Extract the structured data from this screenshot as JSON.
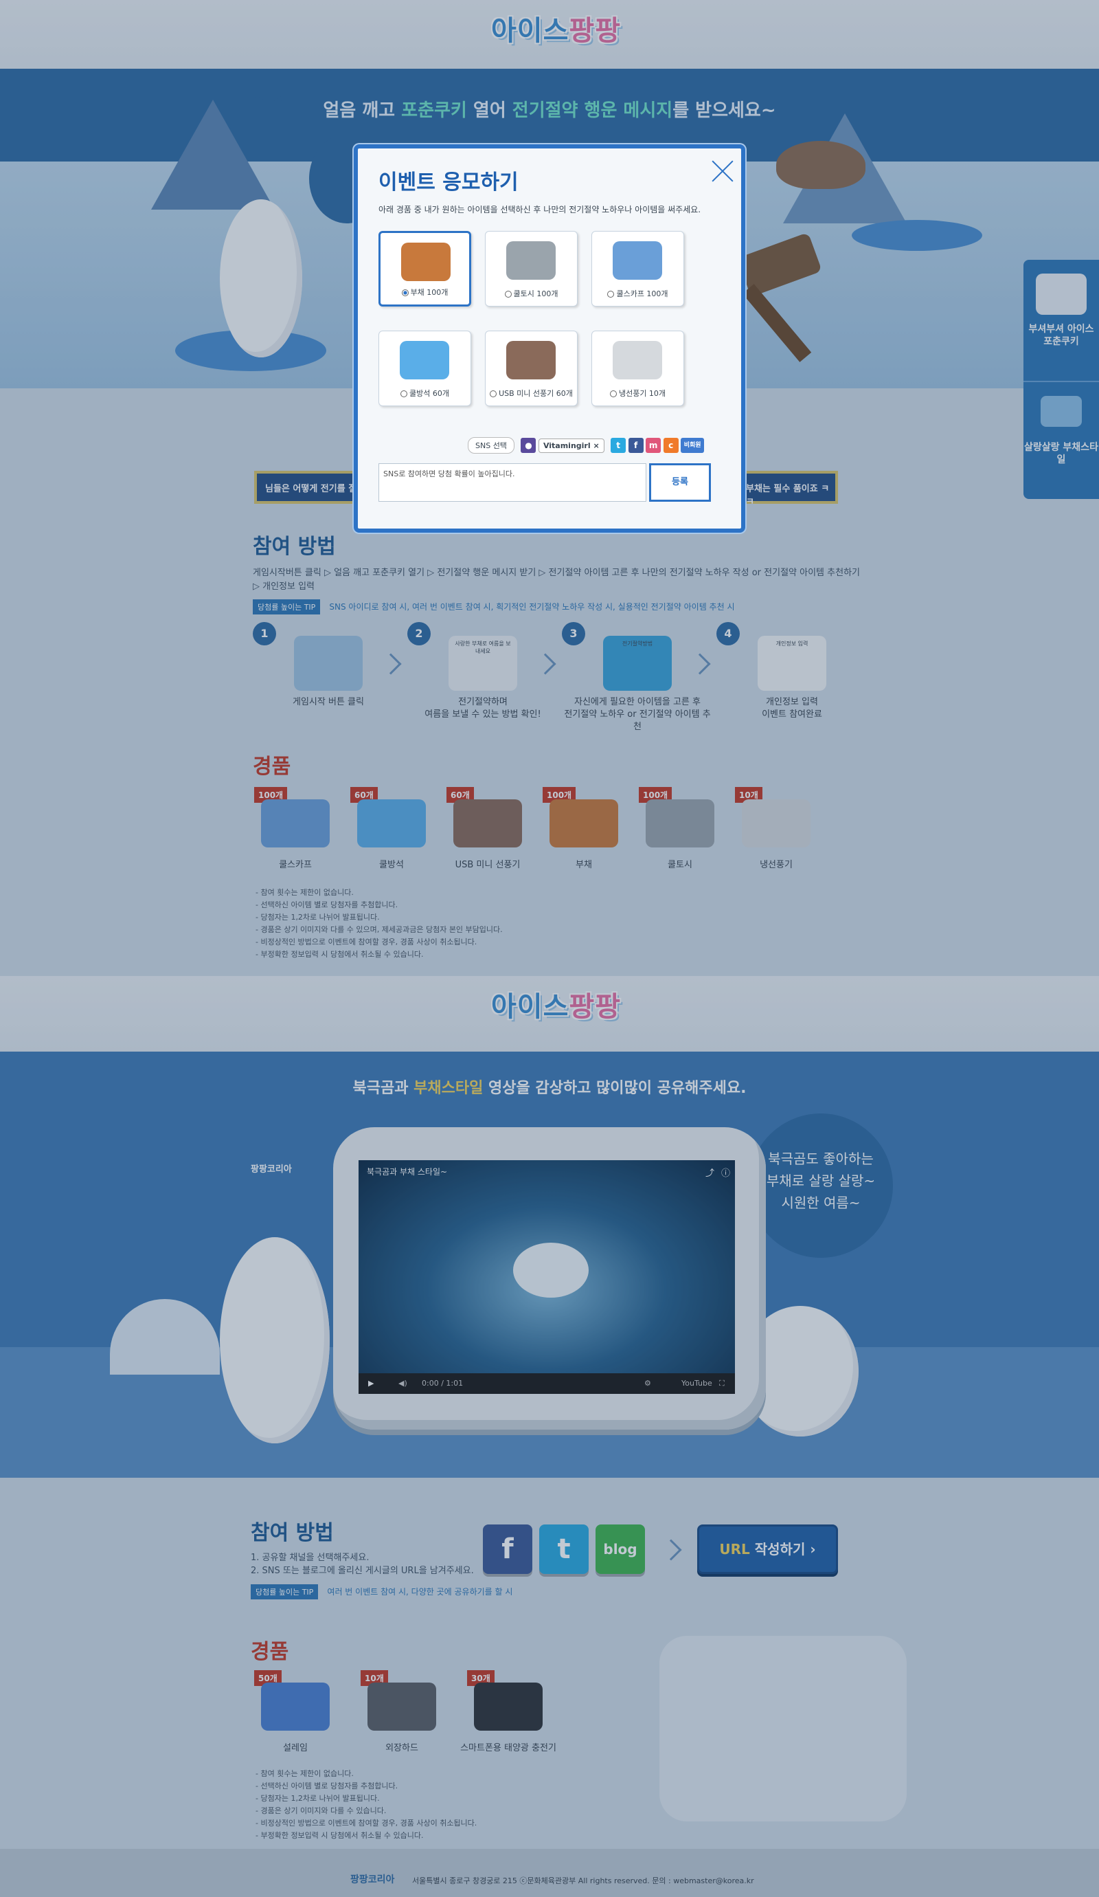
{
  "logo": {
    "part1": "아이스",
    "part2": "팡팡"
  },
  "hero": {
    "line": [
      {
        "t": "얼음 깨고 ",
        "c": ""
      },
      {
        "t": "포춘쿠키",
        "c": "g"
      },
      {
        "t": " 열어 ",
        "c": ""
      },
      {
        "t": "전기절약 행운 메시지",
        "c": "g"
      },
      {
        "t": "를 받으세요~",
        "c": ""
      }
    ]
  },
  "brand_small": "팡팡코리아",
  "banner": {
    "left": "님들은 어떻게 전기를 절",
    "right": "부채는 필수 품이죠 ㅋㅋ"
  },
  "modal": {
    "title": "이벤트 응모하기",
    "desc": "아래 경품 중 내가 원하는 아이템을 선택하신 후 나만의 전기절약 노하우나 아이템을 써주세요.",
    "items": [
      {
        "label": "부채 100개",
        "selected": true
      },
      {
        "label": "쿨토시 100개",
        "selected": false
      },
      {
        "label": "쿨스카프 100개",
        "selected": false
      },
      {
        "label": "쿨방석 60개",
        "selected": false
      },
      {
        "label": "USB 미니 선풍기 60개",
        "selected": false
      },
      {
        "label": "냉선풍기 10개",
        "selected": false
      }
    ],
    "sns_label": "SNS 선택",
    "user_name": "Vitamingirl",
    "anon_label": "비회원",
    "textarea_value": "SNS로 참여하면 당첨 확률이 높아집니다.",
    "submit": "등록"
  },
  "side_menu": [
    {
      "label": "부셔부셔 아이스 포춘쿠키"
    },
    {
      "label": "살랑살랑 부채스타일"
    }
  ],
  "section1": {
    "how_title": "참여 방법",
    "how_line1": "게임시작버튼 클릭  ▷  얼음 깨고 포춘쿠키 열기  ▷  전기절약 행운 메시지 받기  ▷  전기절약 아이템 고른 후 나만의 전기절약 노하우 작성 or 전기절약 아이템 추천하기",
    "how_line2": "▷  개인정보 입력",
    "tip_badge": "당첨률 높이는 TIP",
    "tip_text": "SNS 아이디로 참여 시, 여러 번 이벤트 참여 시, 획기적인 전기절약 노하우 작성 시, 실용적인 전기절약 아이템 추천 시",
    "steps": [
      {
        "num": "1",
        "caption": "게임시작 버튼 클릭"
      },
      {
        "num": "2",
        "caption": "전기절약하며\n여름을 보낼 수 있는 방법 확인!"
      },
      {
        "num": "3",
        "caption": "자신에게 필요한 아이템을 고른 후\n전기절약 노하우 or 전기절약 아이템 추천"
      },
      {
        "num": "4",
        "caption": "개인정보 입력\n이벤트 참여완료"
      }
    ],
    "step2_card": "사랑한 부채로 여름을 보내세요",
    "step3_card": "전기절약방법",
    "step4_card": "개인정보 입력",
    "prize_title": "경품",
    "prizes": [
      {
        "badge": "100개",
        "name": "쿨스카프"
      },
      {
        "badge": "60개",
        "name": "쿨방석"
      },
      {
        "badge": "60개",
        "name": "USB 미니 선풍기"
      },
      {
        "badge": "100개",
        "name": "부채"
      },
      {
        "badge": "100개",
        "name": "쿨토시"
      },
      {
        "badge": "10개",
        "name": "냉선풍기"
      }
    ],
    "notes": [
      "- 참여 횟수는 제한이 없습니다.",
      "- 선택하신 아이템 별로 당첨자를 추첨합니다.",
      "- 당첨자는 1,2차로 나뉘어 발표됩니다.",
      "- 경품은 상기 이미지와 다를 수 있으며, 제세공과금은 당첨자 본인 부담입니다.",
      "- 비정상적인 방법으로 이벤트에 참여할 경우, 경품 사상이 취소됩니다.",
      "- 부정확한 정보입력 시 당첨에서 취소될 수 있습니다."
    ]
  },
  "section2": {
    "title": [
      {
        "t": "북극곰과 ",
        "c": ""
      },
      {
        "t": "부채스타일",
        "c": "y"
      },
      {
        "t": " 영상을 감상하고 많이많이 공유해주세요.",
        "c": ""
      }
    ],
    "video_title": "북극곰과 부채 스타일~",
    "video_time": "0:00 / 1:01",
    "video_brand": "YouTube",
    "speech": [
      "북극곰도 좋아하는",
      "부채로 살랑 살랑~",
      "시원한 여름~"
    ],
    "how_title": "참여 방법",
    "how_lines": [
      "1. 공유할 채널을 선택해주세요.",
      "2. SNS 또는 블로그에 올리신 게시글의 URL을 남겨주세요."
    ],
    "tip_badge": "당첨률 높이는 TIP",
    "tip_text": "여러 번 이벤트 참여 시, 다양한 곳에 공유하기를 할 시",
    "sns_buttons": [
      {
        "label": "f",
        "name": "facebook",
        "color": "#3b5998"
      },
      {
        "label": "t",
        "name": "twitter",
        "color": "#2aa9e0"
      },
      {
        "label": "blog",
        "name": "blog",
        "color": "#3fb34f"
      }
    ],
    "url_button": {
      "y": "URL",
      "rest": " 작성하기 ›"
    },
    "prize_title": "경품",
    "prizes": [
      {
        "badge": "50개",
        "name": "설레임"
      },
      {
        "badge": "10개",
        "name": "외장하드"
      },
      {
        "badge": "30개",
        "name": "스마트폰용 태양광 충전기"
      }
    ],
    "notes": [
      "- 참여 횟수는 제한이 없습니다.",
      "- 선택하신 아이템 별로 당첨자를 추첨합니다.",
      "- 당첨자는 1,2차로 나뉘어 발표됩니다.",
      "- 경품은 상기 이미지와 다를 수 있습니다.",
      "- 비정상적인 방법으로 이벤트에 참여할 경우, 경품 사상이 취소됩니다.",
      "- 부정확한 정보입력 시 당첨에서 취소될 수 있습니다."
    ]
  },
  "footer": {
    "text": "서울특별시 종로구 창경궁로 215  ⓒ문화체육관광부  All rights reserved.  문의 : webmaster@korea.kr"
  },
  "colors": {
    "primary": "#2d73c6",
    "dark_band": "#2f6ba4",
    "accent_red": "#c23a28",
    "accent_yellow": "#f2d35c"
  }
}
